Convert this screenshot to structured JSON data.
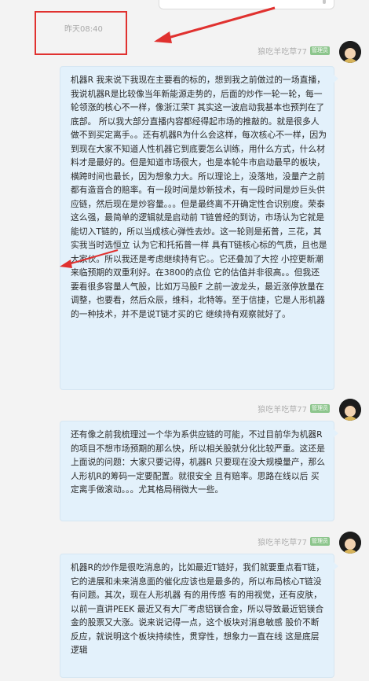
{
  "timestamp": "昨天08:40",
  "messages": [
    {
      "sender": "狼吃羊吃草77",
      "badge": "管理员",
      "text": "机器R 我来说下我现在主要看的标的，想到我之前做过的一场直播，我说机器R是比较像当年新能源走势的，后面的炒作一轮一轮，每一轮领涨的核心不一样，像浙江荣T 其实这一波启动我基本也预判在了底部。 所以我大部分直播内容都经得起市场的推敲的。就是很多人做不到买定离手。。还有机器R为什么会这样，每次核心不一样，因为到现在大家不知道人性机器它到底要怎么训练，用什么方式，什么材料才是最好的。但是知道市场很大，也是本轮牛市启动最早的板块，横跨时间也最长，因为想象力大。所以理论上，没落地，没量产之前 都有造音合的赔率。有一段时间是炒新技术，有一段时间是炒巨头供应链，然后现在是炒容量。。。但是最终离不开确定性合识别度。荣泰这么强，最简单的逻辑就是启动前 T链曾经的到访，市场认为它就是能切入T链的，所以当成核心弹性去炒。这一轮则是拓普，三花，其实我当时选恒立 认为它和托拓普一样 具有T链核心标的气质，且也是大家伙。所以我还是考虑继续持有它。。它还叠加了大控 小控更新潮来临预期的双重利好。在3800的点位 它的估值并非很高。。但我还要看很多容量人气股，比如万马股F 之前一波龙头，最近涨停放量在调整，也要看，然后众辰，维科，北特等。至于信捷，它是人形机器的一种技术，并不是说T链才买的它 继续持有观察就好了。"
    },
    {
      "sender": "狼吃羊吃草77",
      "badge": "管理员",
      "text": "还有像之前我梳理过一个华为系供应链的可能，不过目前华为机器R的项目不想市场预期的那么快，所以相关股就分化比较严重。这还是上面说的问题：大家只要记得，机器R 只要现在没大规模量产，那么人形机R的筹码一定要配置。就很安全 且有赔率。思路在线以后 买定离手做滚动。。。尤其格局稍微大一些。"
    },
    {
      "sender": "狼吃羊吃草77",
      "badge": "管理员",
      "text": "机器R的炒作是很吃消息的，比如最近T链好，我们就要重点看T链，它的进展和未来消息面的催化应该也是最多的，所以布局核心T链没有问题。其次，现在人形机器 有的用传感 有的用视觉，还有皮肤，以前一直讲PEEK 最近又有大厂考虑铝镁合金，所以导致最近铝镁合金的股票又大涨。说来说记得一点，这个板块对消息敏感 股价不断反应，就说明这个板块持续性，贯穿性，想象力一直在线 这是底层逻辑"
    }
  ]
}
